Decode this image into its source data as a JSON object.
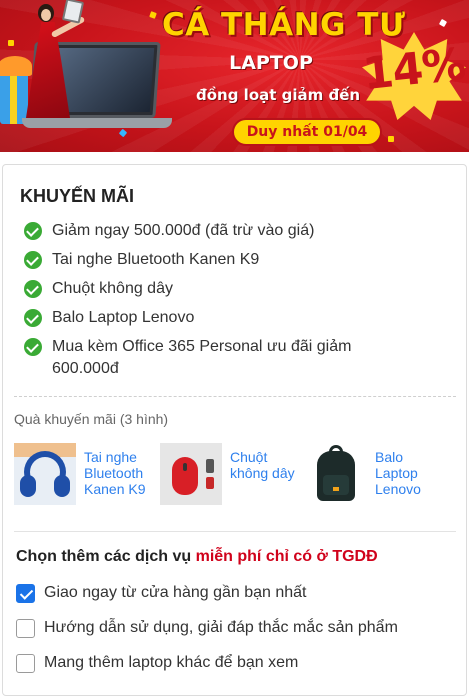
{
  "banner": {
    "headline": "CÁ THÁNG TƯ",
    "product": "LAPTOP",
    "subline": "đồng loạt giảm đến",
    "discount": "14%",
    "date_badge": "Duy nhất 01/04",
    "accent_color": "#c8141b",
    "highlight_color": "#ffd400"
  },
  "promo": {
    "title": "KHUYẾN MÃI",
    "items": [
      "Giảm ngay 500.000đ (đã trừ vào giá)",
      "Tai nghe Bluetooth Kanen K9",
      "Chuột không dây",
      "Balo Laptop Lenovo",
      "Mua kèm Office 365 Personal ưu đãi giảm 600.000đ"
    ],
    "item_icon": "check-circle-icon",
    "item_icon_color": "#3aaa35"
  },
  "gifts": {
    "caption": "Quà khuyến mãi (3 hình)",
    "items": [
      {
        "label": "Tai nghe Bluetooth Kanen K9",
        "icon": "headphone-image"
      },
      {
        "label": "Chuột không dây",
        "icon": "wireless-mouse-image"
      },
      {
        "label": "Balo Laptop Lenovo",
        "icon": "backpack-image"
      }
    ],
    "link_color": "#2f80ed"
  },
  "services": {
    "title_prefix": "Chọn thêm các dịch vụ ",
    "title_highlight": "miễn phí chỉ có ở TGDĐ",
    "highlight_color": "#d0021b",
    "options": [
      {
        "label": "Giao ngay từ cửa hàng gần bạn nhất",
        "checked": true
      },
      {
        "label": "Hướng dẫn sử dụng, giải đáp thắc mắc sản phẩm",
        "checked": false
      },
      {
        "label": "Mang thêm laptop khác để bạn xem",
        "checked": false
      }
    ]
  }
}
